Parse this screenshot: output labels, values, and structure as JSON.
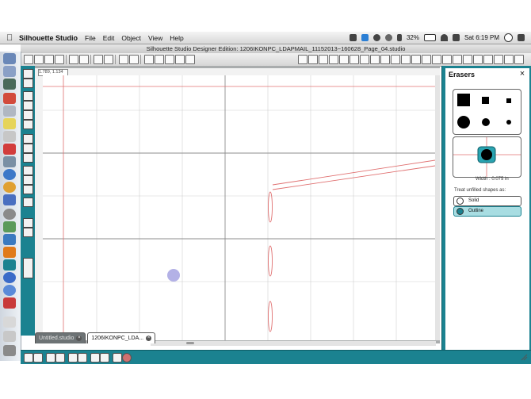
{
  "menubar": {
    "app_name": "Silhouette Studio",
    "menu": [
      "File",
      "Edit",
      "Object",
      "View",
      "Help"
    ],
    "battery": "32%",
    "clock": "Sat 6:19 PM"
  },
  "window": {
    "title": "Silhouette Studio Designer Edition: 1206IKONPC_LDAPMAIL_11152013~160628_Page_04.studio"
  },
  "canvas": {
    "coordinate_readout": "1.789, 1.134"
  },
  "tabs": [
    {
      "label": "Untitled.studio",
      "active": false
    },
    {
      "label": "1206IKONPC_LDA...",
      "active": true
    }
  ],
  "erasers_panel": {
    "title": "Erasers",
    "width_label": "Width : 0.075 in",
    "treat_label": "Treat unfilled shapes as:",
    "options": [
      {
        "label": "Solid",
        "selected": false
      },
      {
        "label": "Outline",
        "selected": true
      }
    ]
  },
  "colors": {
    "teal": "#1b8290",
    "guide_red": "#e07070",
    "cursor_lavender": "#b3b1e6",
    "outline_selected": "#a8dde2"
  }
}
